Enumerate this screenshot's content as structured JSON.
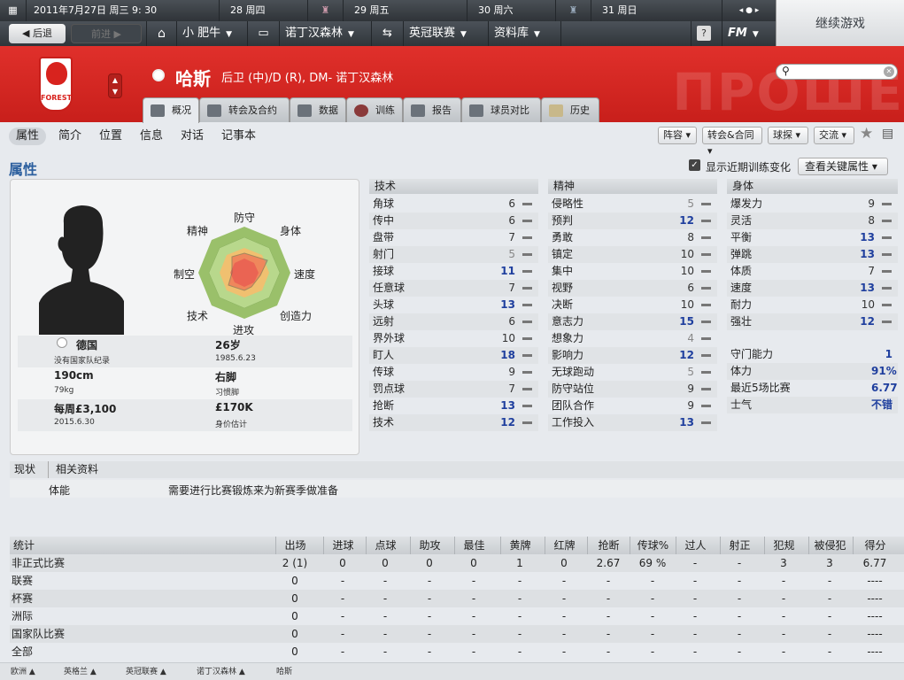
{
  "topbar": {
    "date": "2011年7月27日 周三  9: 30",
    "days": [
      "28 周四",
      "29 周五",
      "30 周六",
      "31 周日"
    ]
  },
  "nav": {
    "back": "后退",
    "forward": "前进",
    "menus": [
      "小 肥牛",
      "诺丁汉森林",
      "英冠联赛",
      "资料库"
    ],
    "help": "?",
    "fm": "FM"
  },
  "continue": "继续游戏",
  "player": {
    "name": "哈斯",
    "desc": "后卫 (中)/D (R), DM- 诺丁汉森林",
    "club_short": "FOREST"
  },
  "watermark": "ПРОШЕ",
  "tabs": [
    "概况",
    "转会及合约",
    "数据",
    "训练",
    "报告",
    "球员对比",
    "历史"
  ],
  "subnav": [
    "属性",
    "简介",
    "位置",
    "信息",
    "对话",
    "记事本"
  ],
  "dropdowns": [
    "阵容",
    "转会&合同",
    "球探",
    "交流"
  ],
  "attributes_title": "属性",
  "show_training": "显示近期训练变化",
  "key_attr": "查看关键属性",
  "radar": [
    "防守",
    "身体",
    "速度",
    "创造力",
    "进攻",
    "技术",
    "制空",
    "精神"
  ],
  "bio": {
    "nation": "德国",
    "age": "26岁",
    "caps": "没有国家队纪录",
    "dob": "1985.6.23",
    "height": "190cm",
    "foot": "右脚",
    "weight": "79kg",
    "foot_label": "习惯脚",
    "wage": "每周£3,100",
    "value": "£170K",
    "contract": "2015.6.30",
    "value_label": "身价估计"
  },
  "technical": {
    "title": "技术",
    "items": [
      [
        "角球",
        "6"
      ],
      [
        "传中",
        "6"
      ],
      [
        "盘带",
        "7"
      ],
      [
        "射门",
        "5"
      ],
      [
        "接球",
        "11"
      ],
      [
        "任意球",
        "7"
      ],
      [
        "头球",
        "13"
      ],
      [
        "远射",
        "6"
      ],
      [
        "界外球",
        "10"
      ],
      [
        "盯人",
        "18"
      ],
      [
        "传球",
        "9"
      ],
      [
        "罚点球",
        "7"
      ],
      [
        "抢断",
        "13"
      ],
      [
        "技术",
        "12"
      ]
    ]
  },
  "mental": {
    "title": "精神",
    "items": [
      [
        "侵略性",
        "5"
      ],
      [
        "预判",
        "12"
      ],
      [
        "勇敢",
        "8"
      ],
      [
        "镇定",
        "10"
      ],
      [
        "集中",
        "10"
      ],
      [
        "视野",
        "6"
      ],
      [
        "决断",
        "10"
      ],
      [
        "意志力",
        "15"
      ],
      [
        "想象力",
        "4"
      ],
      [
        "影响力",
        "12"
      ],
      [
        "无球跑动",
        "5"
      ],
      [
        "防守站位",
        "9"
      ],
      [
        "团队合作",
        "9"
      ],
      [
        "工作投入",
        "13"
      ]
    ]
  },
  "physical": {
    "title": "身体",
    "items": [
      [
        "爆发力",
        "9"
      ],
      [
        "灵活",
        "8"
      ],
      [
        "平衡",
        "13"
      ],
      [
        "弹跳",
        "13"
      ],
      [
        "体质",
        "7"
      ],
      [
        "速度",
        "13"
      ],
      [
        "耐力",
        "10"
      ],
      [
        "强壮",
        "12"
      ]
    ]
  },
  "extra": [
    [
      "守门能力",
      "1"
    ],
    [
      "体力",
      "91%"
    ],
    [
      "最近5场比赛",
      "6.77"
    ],
    [
      "士气",
      "不错"
    ]
  ],
  "status": {
    "h1": "现状",
    "h2": "相关资料",
    "label": "体能",
    "text": "需要进行比赛锻炼来为新赛季做准备"
  },
  "stats": {
    "headers": [
      "统计",
      "出场",
      "进球",
      "点球",
      "助攻",
      "最佳",
      "黄牌",
      "红牌",
      "抢断",
      "传球%",
      "过人",
      "射正",
      "犯规",
      "被侵犯",
      "得分"
    ],
    "rows": [
      [
        "非正式比赛",
        "2 (1)",
        "0",
        "0",
        "0",
        "0",
        "1",
        "0",
        "2.67",
        "69 %",
        "-",
        "-",
        "3",
        "3",
        "6.77"
      ],
      [
        "联赛",
        "0",
        "-",
        "-",
        "-",
        "-",
        "-",
        "-",
        "-",
        "-",
        "-",
        "-",
        "-",
        "-",
        "----"
      ],
      [
        "杯赛",
        "0",
        "-",
        "-",
        "-",
        "-",
        "-",
        "-",
        "-",
        "-",
        "-",
        "-",
        "-",
        "-",
        "----"
      ],
      [
        "洲际",
        "0",
        "-",
        "-",
        "-",
        "-",
        "-",
        "-",
        "-",
        "-",
        "-",
        "-",
        "-",
        "-",
        "----"
      ],
      [
        "国家队比赛",
        "0",
        "-",
        "-",
        "-",
        "-",
        "-",
        "-",
        "-",
        "-",
        "-",
        "-",
        "-",
        "-",
        "----"
      ],
      [
        "全部",
        "0",
        "-",
        "-",
        "-",
        "-",
        "-",
        "-",
        "-",
        "-",
        "-",
        "-",
        "-",
        "-",
        "----"
      ]
    ]
  },
  "breadcrumbs": [
    "欧洲",
    "英格兰",
    "英冠联赛",
    "诺丁汉森林",
    "哈斯"
  ]
}
